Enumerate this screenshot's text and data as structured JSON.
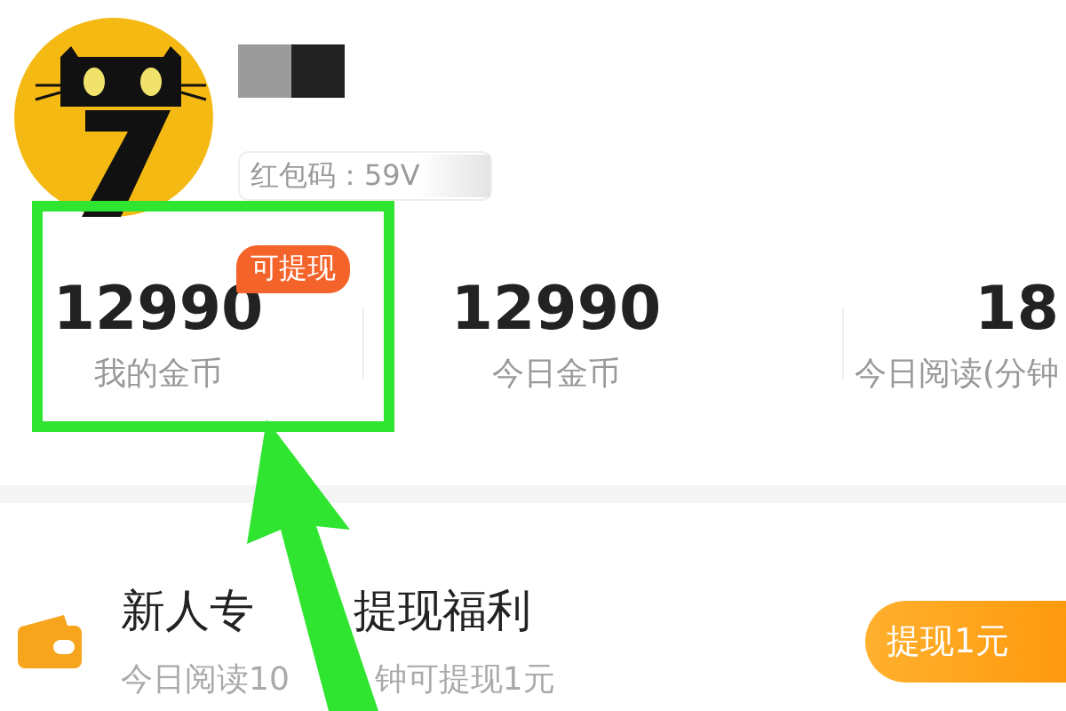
{
  "profile": {
    "invite_code": "红包码：59V"
  },
  "stats": [
    {
      "value": "12990",
      "label": "我的金币",
      "badge": "可提现"
    },
    {
      "value": "12990",
      "label": "今日金币"
    },
    {
      "value": "18",
      "label": "今日阅读(分钟"
    }
  ],
  "promo": {
    "title_parts": [
      "新人专",
      "提现福利"
    ],
    "subtitle_parts": [
      "今日阅读10",
      "钟可提现1元"
    ],
    "button": "提现1元"
  }
}
